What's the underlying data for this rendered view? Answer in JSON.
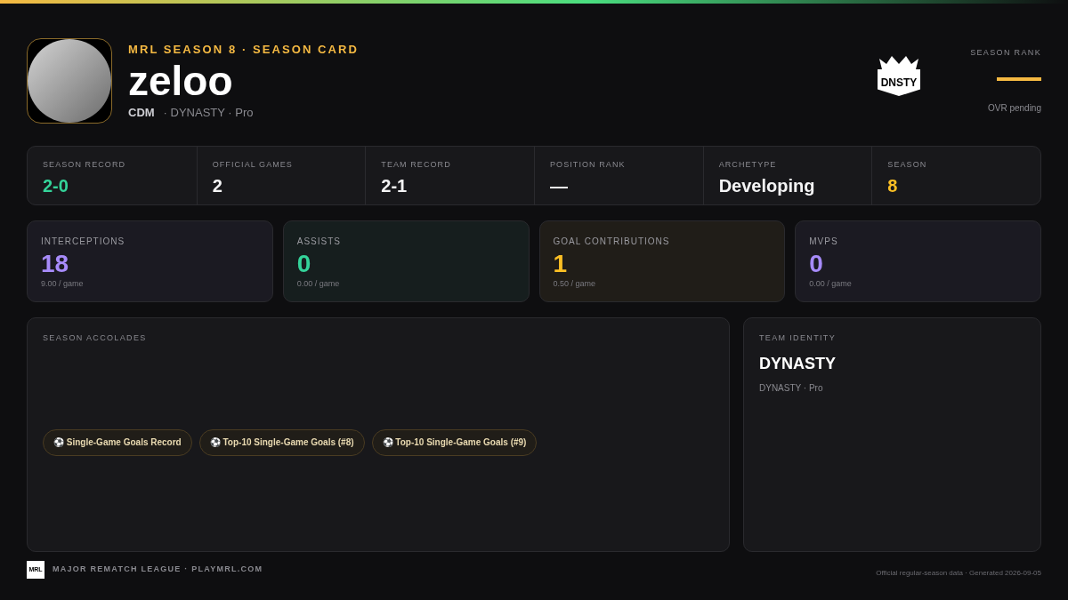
{
  "header": {
    "eyebrow": "MRL SEASON 8 · SEASON CARD",
    "player": "zeloo",
    "position": "CDM",
    "team_line": "· DYNASTY · Pro",
    "team_logo_text": "DNSTY",
    "rank_label": "SEASON RANK",
    "rank_note": "OVR pending"
  },
  "summary": [
    {
      "label": "SEASON RECORD",
      "value": "2-0",
      "color": "#34d399"
    },
    {
      "label": "OFFICIAL GAMES",
      "value": "2",
      "color": "#f4f4f5"
    },
    {
      "label": "TEAM RECORD",
      "value": "2-1",
      "color": "#f4f4f5"
    },
    {
      "label": "POSITION RANK",
      "value": "—",
      "color": "#f4f4f5"
    },
    {
      "label": "ARCHETYPE",
      "value": "Developing",
      "color": "#f4f4f5"
    },
    {
      "label": "SEASON",
      "value": "8",
      "color": "#fbbf24"
    }
  ],
  "stats": [
    {
      "label": "INTERCEPTIONS",
      "value": "18",
      "per_game": "9.00 / game",
      "color": "#a78bfa"
    },
    {
      "label": "ASSISTS",
      "value": "0",
      "per_game": "0.00 / game",
      "color": "#34d399"
    },
    {
      "label": "GOAL CONTRIBUTIONS",
      "value": "1",
      "per_game": "0.50 / game",
      "color": "#fbbf24"
    },
    {
      "label": "MVPS",
      "value": "0",
      "per_game": "0.00 / game",
      "color": "#a78bfa"
    }
  ],
  "accolades": {
    "title": "SEASON ACCOLADES",
    "items": [
      "⚽ Single-Game Goals Record",
      "⚽ Top-10 Single-Game Goals (#8)",
      "⚽ Top-10 Single-Game Goals (#9)"
    ]
  },
  "team_identity": {
    "title": "TEAM IDENTITY",
    "name": "DYNASTY",
    "subtitle": "DYNASTY · Pro"
  },
  "footer": {
    "logo_text": "MRL",
    "league": "MAJOR REMATCH LEAGUE · PLAYMRL.COM",
    "note": "Official regular-season data · Generated 2026-09-05"
  }
}
